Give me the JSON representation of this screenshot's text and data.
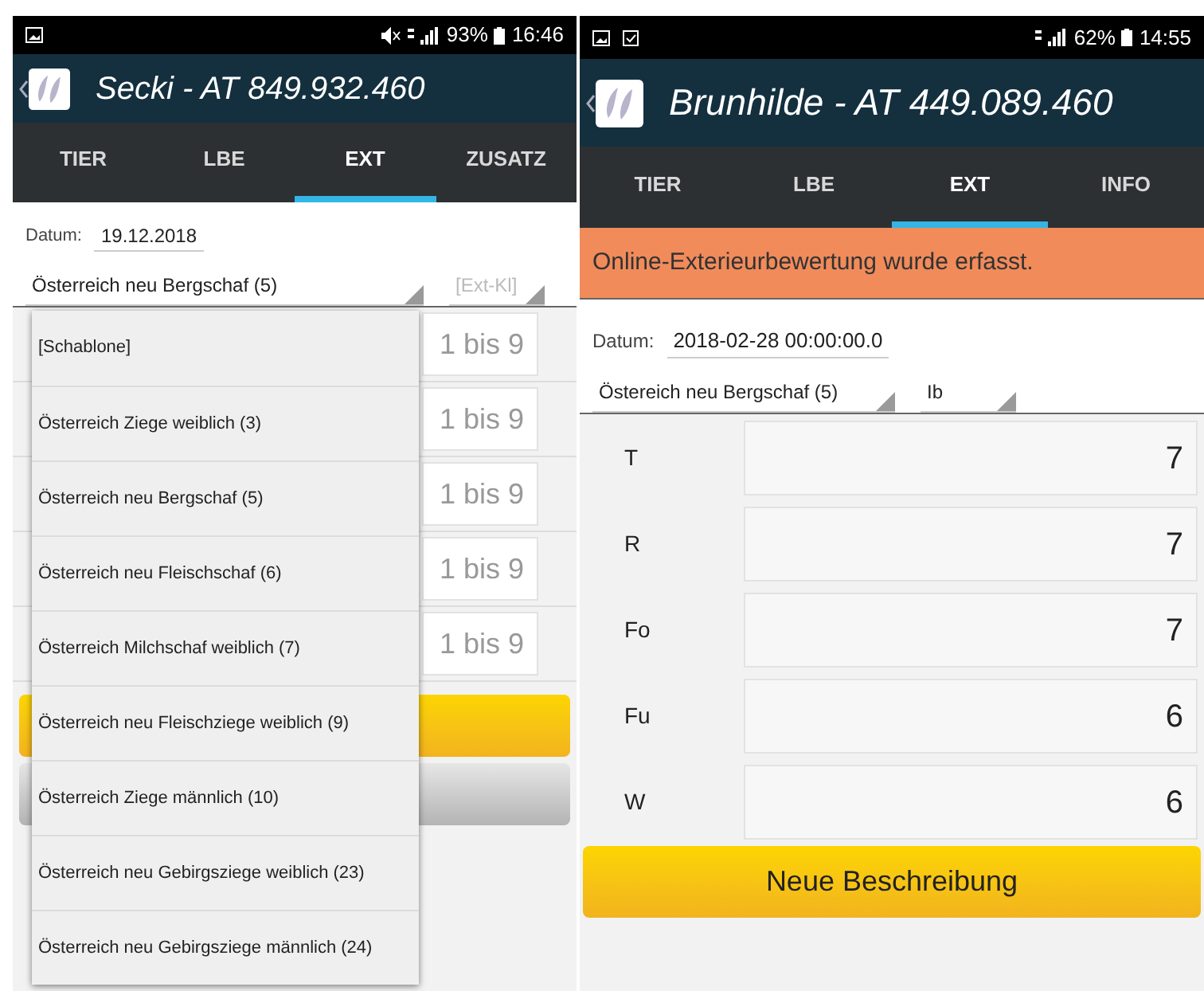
{
  "screens": [
    {
      "status_bar": {
        "battery": "93%",
        "time": "16:46"
      },
      "title": "Secki - AT 849.932.460",
      "tabs": [
        {
          "label": "TIER",
          "selected": false
        },
        {
          "label": "LBE",
          "selected": false
        },
        {
          "label": "EXT",
          "selected": true
        },
        {
          "label": "ZUSATZ",
          "selected": false
        }
      ],
      "date_label": "Datum:",
      "date_value": "19.12.2018",
      "selects": [
        {
          "value": "Österreich neu Bergschaf (5)"
        },
        {
          "placeholder": "[Ext-Kl]"
        }
      ],
      "rows": [
        {
          "placeholder": "1 bis 9"
        },
        {
          "placeholder": "1 bis 9"
        },
        {
          "placeholder": "1 bis 9"
        },
        {
          "placeholder": "1 bis 9"
        },
        {
          "placeholder": "1 bis 9"
        }
      ],
      "buttons": [
        {
          "kind": "primary"
        },
        {
          "kind": "secondary"
        }
      ],
      "dropdown_menu": [
        "[Schablone]",
        "Österreich Ziege weiblich (3)",
        "Österreich neu Bergschaf (5)",
        "Österreich neu Fleischschaf (6)",
        "Österreich Milchschaf weiblich (7)",
        "Österreich neu Fleischziege weiblich (9)",
        "Österreich Ziege männlich (10)",
        "Österreich neu Gebirgsziege weiblich (23)",
        "Österreich neu Gebirgsziege männlich (24)"
      ]
    },
    {
      "status_bar": {
        "battery": "62%",
        "time": "14:55"
      },
      "title": "Brunhilde - AT 449.089.460",
      "tabs": [
        {
          "label": "TIER",
          "selected": false
        },
        {
          "label": "LBE",
          "selected": false
        },
        {
          "label": "EXT",
          "selected": true
        },
        {
          "label": "INFO",
          "selected": false
        }
      ],
      "banner": "Online-Exterieurbewertung wurde erfasst.",
      "date_label": "Datum:",
      "date_value": "2018-02-28 00:00:00.0",
      "selects": [
        {
          "value": "Östereich neu Bergschaf (5)"
        },
        {
          "value": "Ib"
        }
      ],
      "rows": [
        {
          "label": "T",
          "value": "7"
        },
        {
          "label": "R",
          "value": "7"
        },
        {
          "label": "Fo",
          "value": "7"
        },
        {
          "label": "Fu",
          "value": "6"
        },
        {
          "label": "W",
          "value": "6"
        }
      ],
      "buttons": [
        {
          "kind": "primary",
          "label": "Neue Beschreibung"
        }
      ]
    }
  ]
}
